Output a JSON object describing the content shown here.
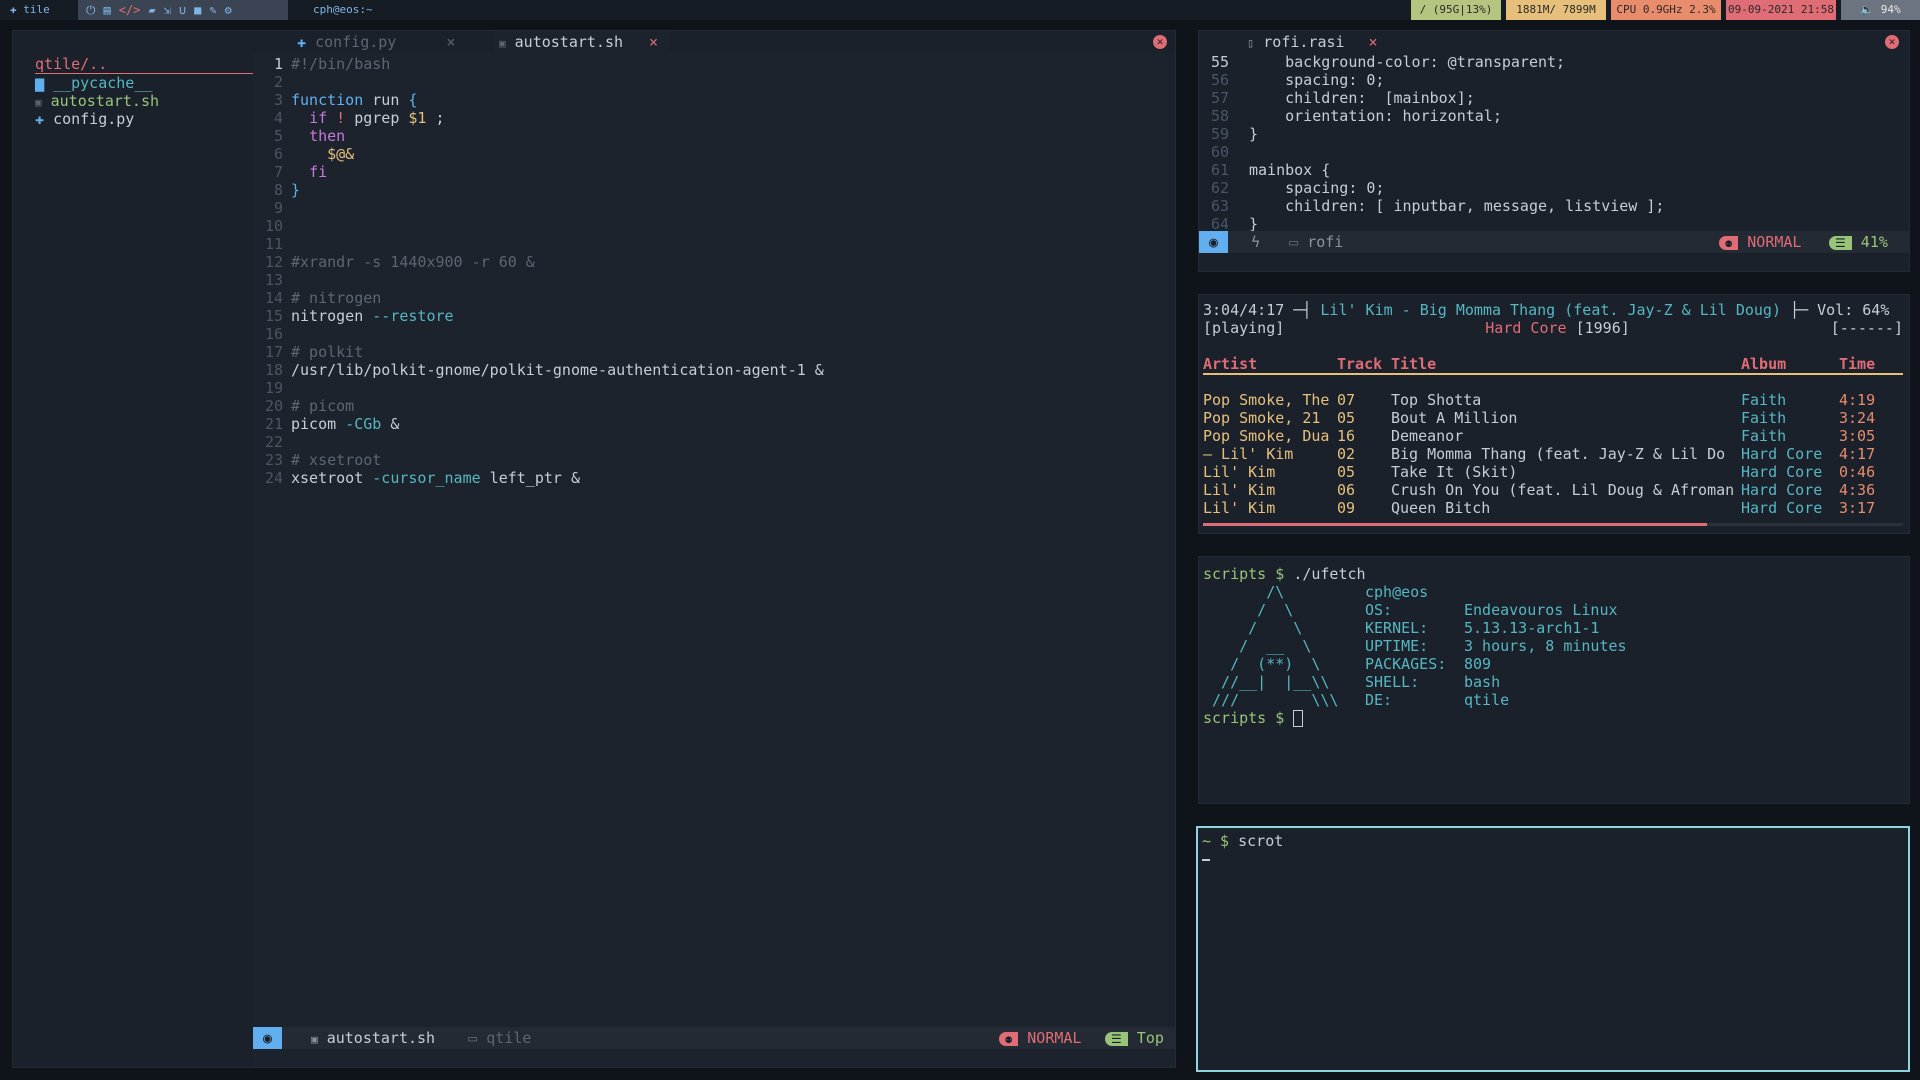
{
  "topbar": {
    "tile_name": "tile",
    "workspace_icons": [
      "power-icon",
      "terminal-icon",
      "code-icon",
      "folder-icon",
      "arrow-icon",
      "magnet-icon",
      "video-icon",
      "edit-icon",
      "gear-icon"
    ],
    "window_title": "cph@eos:~",
    "widgets": {
      "disk": "/ (95G|13%)",
      "memory": "1881M/ 7899M",
      "cpu": "CPU 0.9GHz 2.3%",
      "date": "09-09-2021 21:58",
      "volume": "94%"
    },
    "colors": {
      "disk": "#b3c57f",
      "memory": "#e6c07b",
      "cpu": "#e88c6b",
      "date": "#e06c75",
      "volume": "#6b7480"
    }
  },
  "filetree": {
    "root": "qtile/..",
    "items": [
      {
        "icon": "folder-icon",
        "name": "__pycache__"
      },
      {
        "icon": "file-icon",
        "name": "autostart.sh"
      },
      {
        "icon": "python-icon",
        "name": "config.py"
      }
    ]
  },
  "editor": {
    "tabs": [
      {
        "label": "config.py",
        "icon": "python-icon",
        "close": "×"
      },
      {
        "label": "autostart.sh",
        "icon": "file-icon",
        "close": "×"
      }
    ],
    "lines": [
      {
        "n": "1",
        "t": "#!/bin/bash"
      },
      {
        "n": "2",
        "t": ""
      },
      {
        "n": "3",
        "t": "function run {"
      },
      {
        "n": "4",
        "t": "  if ! pgrep $1 ;"
      },
      {
        "n": "5",
        "t": "  then"
      },
      {
        "n": "6",
        "t": "    $@&"
      },
      {
        "n": "7",
        "t": "  fi"
      },
      {
        "n": "8",
        "t": "}"
      },
      {
        "n": "9",
        "t": ""
      },
      {
        "n": "10",
        "t": ""
      },
      {
        "n": "11",
        "t": ""
      },
      {
        "n": "12",
        "t": "#xrandr -s 1440x900 -r 60 &"
      },
      {
        "n": "13",
        "t": ""
      },
      {
        "n": "14",
        "t": "# nitrogen"
      },
      {
        "n": "15",
        "t": "nitrogen --restore"
      },
      {
        "n": "16",
        "t": ""
      },
      {
        "n": "17",
        "t": "# polkit"
      },
      {
        "n": "18",
        "t": "/usr/lib/polkit-gnome/polkit-gnome-authentication-agent-1 &"
      },
      {
        "n": "19",
        "t": ""
      },
      {
        "n": "20",
        "t": "# picom"
      },
      {
        "n": "21",
        "t": "picom -CGb &"
      },
      {
        "n": "22",
        "t": ""
      },
      {
        "n": "23",
        "t": "# xsetroot"
      },
      {
        "n": "24",
        "t": "xsetroot -cursor_name left_ptr &"
      }
    ],
    "status": {
      "file": "autostart.sh",
      "dir": "qtile",
      "mode": "NORMAL",
      "position": "Top"
    }
  },
  "rofi_editor": {
    "tab": "rofi.rasi",
    "tab_close": "×",
    "lines": [
      {
        "n": "55",
        "t": "    background-color: @transparent;"
      },
      {
        "n": "56",
        "t": "    spacing: 0;"
      },
      {
        "n": "57",
        "t": "    children:  [mainbox];"
      },
      {
        "n": "58",
        "t": "    orientation: horizontal;"
      },
      {
        "n": "59",
        "t": "}"
      },
      {
        "n": "60",
        "t": ""
      },
      {
        "n": "61",
        "t": "mainbox {"
      },
      {
        "n": "62",
        "t": "    spacing: 0;"
      },
      {
        "n": "63",
        "t": "    children: [ inputbar, message, listview ];"
      },
      {
        "n": "64",
        "t": "}"
      }
    ],
    "status": {
      "dir": "rofi",
      "mode": "NORMAL",
      "position": "41%"
    }
  },
  "cmus": {
    "now_playing": "3:04/4:17",
    "song": "Lil' Kim - Big Momma Thang (feat. Jay-Z & Lil Doug)",
    "volume": "Vol: 64%",
    "state": "[playing]",
    "album_info_album": "Hard Core",
    "album_info_year": "[1996]",
    "flags": "[------]",
    "headers": {
      "artist": "Artist",
      "track": "Track",
      "title": "Title",
      "album": "Album",
      "time": "Time"
    },
    "tracks": [
      {
        "artist": "Pop Smoke, The",
        "track": "07",
        "title": "Top Shotta",
        "album": "Faith",
        "time": "4:19"
      },
      {
        "artist": "Pop Smoke, 21",
        "track": "05",
        "title": "Bout A Million",
        "album": "Faith",
        "time": "3:24"
      },
      {
        "artist": "Pop Smoke, Dua",
        "track": "16",
        "title": "Demeanor",
        "album": "Faith",
        "time": "3:05"
      },
      {
        "artist": "— Lil' Kim",
        "track": "02",
        "title": "Big Momma Thang (feat. Jay-Z & Lil Do",
        "album": "Hard Core",
        "time": "4:17"
      },
      {
        "artist": "Lil' Kim",
        "track": "05",
        "title": "Take It (Skit)",
        "album": "Hard Core",
        "time": "0:46"
      },
      {
        "artist": "Lil' Kim",
        "track": "06",
        "title": "Crush On You (feat. Lil Doug & Afroman",
        "album": "Hard Core",
        "time": "4:36"
      },
      {
        "artist": "Lil' Kim",
        "track": "09",
        "title": "Queen Bitch",
        "album": "Hard Core",
        "time": "3:17"
      }
    ],
    "progress": 0.72
  },
  "ufetch": {
    "cmd_prompt": "scripts $ ",
    "cmd": "./ufetch",
    "art": [
      "       /\\",
      "      /  \\",
      "     /    \\",
      "    /  __  \\",
      "   /  (**)  \\",
      "  //__|  |__\\\\",
      " ///        \\\\\\"
    ],
    "user": "cph@eos",
    "info": [
      {
        "k": "OS:",
        "v": "Endeavouros Linux"
      },
      {
        "k": "KERNEL:",
        "v": "5.13.13-arch1-1"
      },
      {
        "k": "UPTIME:",
        "v": "3 hours, 8 minutes"
      },
      {
        "k": "PACKAGES:",
        "v": "809"
      },
      {
        "k": "SHELL:",
        "v": "bash"
      },
      {
        "k": "DE:",
        "v": "qtile"
      }
    ],
    "prompt2": "scripts $ "
  },
  "term2": {
    "prompt": "~ $ ",
    "cmd": "scrot"
  }
}
